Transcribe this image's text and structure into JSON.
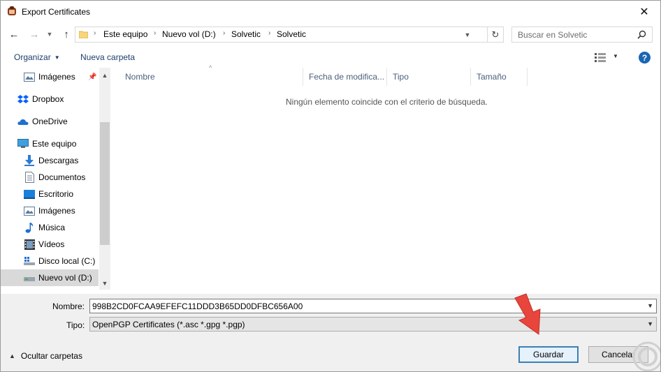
{
  "window": {
    "title": "Export Certificates",
    "close_glyph": "✕"
  },
  "nav": {
    "back_glyph": "←",
    "forward_glyph": "→",
    "recent_glyph": "⌄",
    "up_glyph": "↑",
    "breadcrumb": [
      "Este equipo",
      "Nuevo vol (D:)",
      "Solvetic",
      "Solvetic"
    ],
    "separator": "›",
    "refresh_glyph": "↻",
    "dropdown_glyph": "⌄"
  },
  "search": {
    "placeholder": "Buscar en Solvetic"
  },
  "toolbar": {
    "organize_label": "Organizar",
    "new_folder_label": "Nueva carpeta",
    "help_label": "?"
  },
  "navpane": {
    "items": [
      {
        "label": "Imágenes",
        "icon": "pictures-icon",
        "pinned": true
      },
      {
        "label": "Dropbox",
        "icon": "dropbox-icon"
      },
      {
        "label": "OneDrive",
        "icon": "onedrive-icon"
      },
      {
        "label": "Este equipo",
        "icon": "computer-icon"
      },
      {
        "label": "Descargas",
        "icon": "downloads-icon"
      },
      {
        "label": "Documentos",
        "icon": "documents-icon"
      },
      {
        "label": "Escritorio",
        "icon": "desktop-icon"
      },
      {
        "label": "Imágenes",
        "icon": "pictures-icon"
      },
      {
        "label": "Música",
        "icon": "music-icon"
      },
      {
        "label": "Vídeos",
        "icon": "videos-icon"
      },
      {
        "label": "Disco local (C:)",
        "icon": "drive-icon"
      },
      {
        "label": "Nuevo vol (D:)",
        "icon": "drive-icon",
        "selected": true
      }
    ]
  },
  "columns": [
    "Nombre",
    "Fecha de modifica...",
    "Tipo",
    "Tamaño"
  ],
  "content": {
    "empty_message": "Ningún elemento coincide con el criterio de búsqueda."
  },
  "form": {
    "name_label": "Nombre:",
    "name_value": "998B2CD0FCAA9EFEFC11DDD3B65DD0DFBC656A00",
    "type_label": "Tipo:",
    "type_value": "OpenPGP Certificates (*.asc *.gpg *.pgp)"
  },
  "footer": {
    "hide_folders_label": "Ocultar carpetas",
    "save_label": "Guardar",
    "cancel_label": "Cancelar"
  },
  "colors": {
    "accent": "#3c7fb1",
    "selection": "#cce8ff",
    "annotation": "#e8453c"
  }
}
